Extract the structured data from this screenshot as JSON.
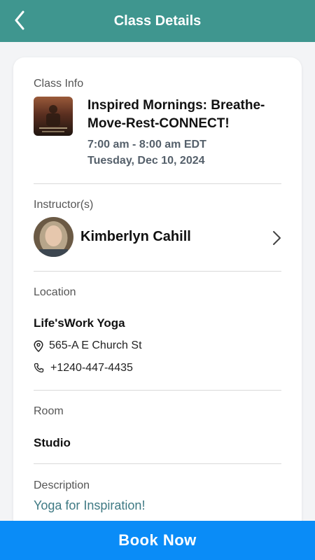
{
  "header": {
    "title": "Class Details"
  },
  "class_info": {
    "label": "Class Info",
    "name": "Inspired Mornings: Breathe-Move-Rest-CONNECT!",
    "time": "7:00 am - 8:00 am EDT",
    "date": "Tuesday, Dec 10, 2024"
  },
  "instructor": {
    "label": "Instructor(s)",
    "name": "Kimberlyn Cahill"
  },
  "location": {
    "label": "Location",
    "name": "Life'sWork Yoga",
    "address": "565-A E Church St",
    "phone": "+1240-447-4435"
  },
  "room": {
    "label": "Room",
    "value": "Studio"
  },
  "description": {
    "label": "Description",
    "value": "Yoga for Inspiration!"
  },
  "footer": {
    "book_label": "Book Now"
  },
  "colors": {
    "header_bg": "#3f968f",
    "button_bg": "#0a8cf7",
    "description_text": "#3f7a84"
  }
}
